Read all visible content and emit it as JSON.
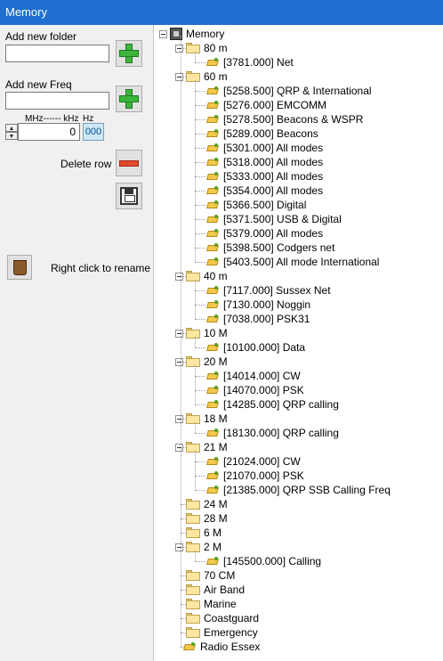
{
  "window": {
    "title": "Memory"
  },
  "left_panel": {
    "add_folder_label": "Add new folder",
    "add_folder_value": "",
    "add_freq_label": "Add new Freq",
    "add_freq_value": "",
    "unit_mhz_khz": "MHz------ kHz",
    "unit_hz": "Hz",
    "freq_main_value": "0",
    "freq_hz_value": "000",
    "delete_row_label": "Delete row",
    "rename_hint": "Right click to rename"
  },
  "tree": {
    "root": "Memory",
    "folders": [
      {
        "name": "80 m",
        "expanded": true,
        "items": [
          "[3781.000] Net"
        ]
      },
      {
        "name": "60 m",
        "expanded": true,
        "items": [
          "[5258.500] QRP & International",
          "[5276.000] EMCOMM",
          "[5278.500] Beacons & WSPR",
          "[5289.000] Beacons",
          "[5301.000] All modes",
          "[5318.000] All modes",
          "[5333.000] All modes",
          "[5354.000] All modes",
          "[5366.500] Digital",
          "[5371.500] USB & Digital",
          "[5379.000] All modes",
          "[5398.500] Codgers net",
          "[5403.500] All mode International"
        ]
      },
      {
        "name": "40 m",
        "expanded": true,
        "items": [
          "[7117.000] Sussex Net",
          "[7130.000] Noggin",
          "[7038.000] PSK31"
        ]
      },
      {
        "name": "10 M",
        "expanded": true,
        "items": [
          "[10100.000] Data"
        ]
      },
      {
        "name": "20 M",
        "expanded": true,
        "items": [
          "[14014.000] CW",
          "[14070.000] PSK",
          "[14285.000] QRP calling"
        ]
      },
      {
        "name": "18 M",
        "expanded": true,
        "items": [
          "[18130.000] QRP calling"
        ]
      },
      {
        "name": "21 M",
        "expanded": true,
        "items": [
          "[21024.000] CW",
          "[21070.000] PSK",
          "[21385.000] QRP SSB Calling Freq"
        ]
      },
      {
        "name": "24 M",
        "expanded": false,
        "items": []
      },
      {
        "name": "28 M",
        "expanded": false,
        "items": []
      },
      {
        "name": "6 M",
        "expanded": false,
        "items": []
      },
      {
        "name": "2 M",
        "expanded": true,
        "items": [
          "[145500.000] Calling"
        ]
      },
      {
        "name": "70 CM",
        "expanded": false,
        "items": []
      },
      {
        "name": "Air Band",
        "expanded": false,
        "items": []
      },
      {
        "name": "Marine",
        "expanded": false,
        "items": []
      },
      {
        "name": "Coastguard",
        "expanded": false,
        "items": []
      },
      {
        "name": "Emergency",
        "expanded": false,
        "items": []
      }
    ],
    "loose_items": [
      "Radio Essex"
    ]
  }
}
